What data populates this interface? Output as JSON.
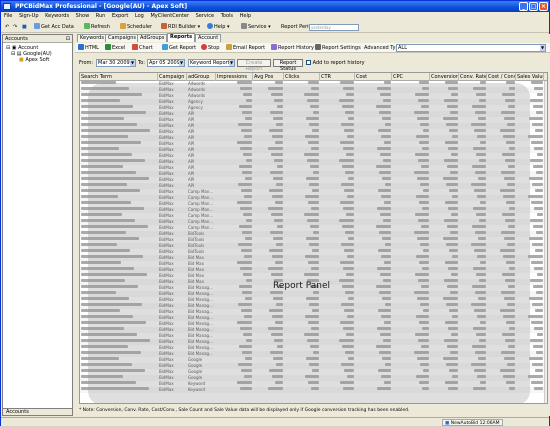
{
  "window": {
    "title": "PPCBidMax Professional - [Google(AU) - Apex Soft]"
  },
  "menu": [
    "File",
    "Sign-Up",
    "Keywords",
    "Show",
    "Run",
    "Export",
    "Log",
    "MyClientCenter",
    "Service",
    "Tools",
    "Help"
  ],
  "toolbar": {
    "get_acc_data": "Get Acc Data",
    "refresh": "Refresh",
    "scheduler": "Scheduler",
    "rdi_builder": "RDI Builder",
    "help": "Help",
    "service": "Service",
    "report_period_label": "Report Period:",
    "report_period_placeholder": "yesterday"
  },
  "left": {
    "title": "Accounts",
    "tree": [
      "Account",
      "Google(AU)",
      "Apex Soft"
    ],
    "footer": "Accounts"
  },
  "tabs": [
    "Keywords",
    "Campaigns",
    "AdGroups",
    "Reports",
    "Account"
  ],
  "report_toolbar": {
    "html": "HTML",
    "excel": "Excel",
    "chart": "Chart",
    "get_report": "Get Report",
    "stop": "Stop",
    "email_report": "Email Report",
    "report_history": "Report History",
    "report_settings": "Report Settings",
    "advanced_type_label": "Advanced Type:",
    "advanced_type_value": "ALL"
  },
  "filters": {
    "from_label": "From:",
    "from_value": "Mar 30 2009",
    "to_label": "To:",
    "to_value": "Apr 05 2009",
    "report_type": "Keyword Report",
    "create_report": "Create Report",
    "report_status": "Report Status",
    "add_history": "Add to report history"
  },
  "grid": {
    "columns": [
      "Search Term",
      "Campaign",
      "adGroup",
      "Impressions",
      "Avg Pos",
      "Clicks",
      "CTR",
      "Cost",
      "CPC",
      "Conversions",
      "Conv. Rate",
      "Cost / Conv.",
      "Sales Value"
    ],
    "rows": [
      [
        "BidMax",
        "Adwords"
      ],
      [
        "BidMax",
        "Adwords"
      ],
      [
        "BidMax",
        "Adwords"
      ],
      [
        "BidMax",
        "Agency"
      ],
      [
        "BidMax",
        "Agency"
      ],
      [
        "BidMax",
        "API"
      ],
      [
        "BidMax",
        "API"
      ],
      [
        "BidMax",
        "API"
      ],
      [
        "BidMax",
        "API"
      ],
      [
        "BidMax",
        "API"
      ],
      [
        "BidMax",
        "API"
      ],
      [
        "BidMax",
        "API"
      ],
      [
        "BidMax",
        "API"
      ],
      [
        "BidMax",
        "API"
      ],
      [
        "BidMax",
        "API"
      ],
      [
        "BidMax",
        "API"
      ],
      [
        "BidMax",
        "API"
      ],
      [
        "BidMax",
        "API"
      ],
      [
        "BidMax",
        "Camp Man..."
      ],
      [
        "BidMax",
        "Camp Man..."
      ],
      [
        "BidMax",
        "Camp Man..."
      ],
      [
        "BidMax",
        "Camp Man..."
      ],
      [
        "BidMax",
        "Camp Man..."
      ],
      [
        "BidMax",
        "Camp Man..."
      ],
      [
        "BidMax",
        "Camp Man..."
      ],
      [
        "BidMax",
        "BidTools"
      ],
      [
        "BidMax",
        "BidTools"
      ],
      [
        "BidMax",
        "BidTools"
      ],
      [
        "BidMax",
        "BidTools"
      ],
      [
        "BidMax",
        "Bid Max"
      ],
      [
        "BidMax",
        "Bid Max"
      ],
      [
        "BidMax",
        "Bid Max"
      ],
      [
        "BidMax",
        "Bid Max"
      ],
      [
        "BidMax",
        "Bid Max"
      ],
      [
        "BidMax",
        "Bid Manag..."
      ],
      [
        "BidMax",
        "Bid Manag..."
      ],
      [
        "BidMax",
        "Bid Manag..."
      ],
      [
        "BidMax",
        "Bid Manag..."
      ],
      [
        "BidMax",
        "Bid Manag..."
      ],
      [
        "BidMax",
        "Bid Manag..."
      ],
      [
        "BidMax",
        "Bid Manag..."
      ],
      [
        "BidMax",
        "Bid Manag..."
      ],
      [
        "BidMax",
        "Bid Manag..."
      ],
      [
        "BidMax",
        "Bid Manag..."
      ],
      [
        "BidMax",
        "Bid Manag..."
      ],
      [
        "BidMax",
        "Bid Manag..."
      ],
      [
        "BidMax",
        "Google"
      ],
      [
        "BidMax",
        "Google"
      ],
      [
        "BidMax",
        "Google"
      ],
      [
        "BidMax",
        "Google"
      ],
      [
        "BidMax",
        "Keyword"
      ],
      [
        "BidMax",
        "Keyword"
      ]
    ]
  },
  "overlay": {
    "label": "Report Panel"
  },
  "note": "* Note: Conversion, Conv. Rate, Cost/Conv., Sale Count and Sale Value data will be displayed only if Google conversion tracking has been enabled.",
  "status": {
    "autobid": "NewAutoBid 12:06AM"
  }
}
